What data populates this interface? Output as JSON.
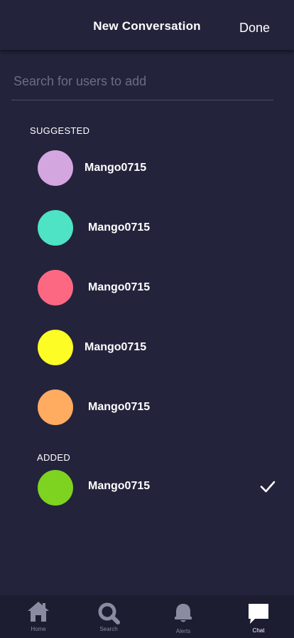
{
  "header": {
    "title": "New Conversation",
    "done_label": "Done"
  },
  "search": {
    "placeholder": "Search for users to add",
    "value": ""
  },
  "suggested": {
    "label": "SUGGESTED",
    "users": [
      {
        "name": "Mango0715",
        "avatar_color": "#d4a6e0"
      },
      {
        "name": "Mango0715",
        "avatar_color": "#4ee3c4"
      },
      {
        "name": "Mango0715",
        "avatar_color": "#fc6882"
      },
      {
        "name": "Mango0715",
        "avatar_color": "#fefc25"
      },
      {
        "name": "Mango0715",
        "avatar_color": "#ffab60"
      }
    ]
  },
  "added": {
    "label": "ADDED",
    "users": [
      {
        "name": "Mango0715",
        "avatar_color": "#7ed321",
        "selected": true,
        "icon": "checkmark-icon"
      }
    ]
  },
  "nav": {
    "items": [
      {
        "label": "Home",
        "icon": "home-icon",
        "active": false
      },
      {
        "label": "Search",
        "icon": "search-icon",
        "active": false
      },
      {
        "label": "Alerts",
        "icon": "bell-icon",
        "active": false
      },
      {
        "label": "Chat",
        "icon": "chat-icon",
        "active": true
      }
    ]
  },
  "colors": {
    "background": "#23233c",
    "nav_background": "#1d1d31",
    "inactive_icon": "#8a8aa0",
    "active_icon": "#ffffff"
  }
}
